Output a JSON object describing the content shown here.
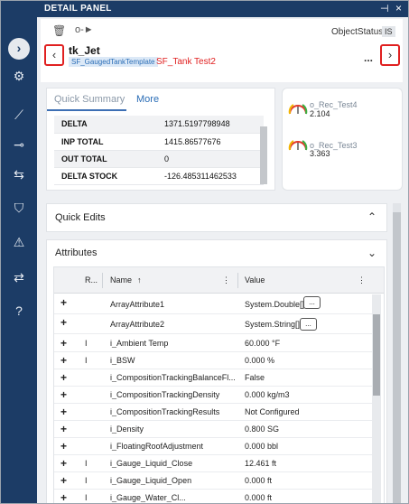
{
  "window": {
    "title": "DETAIL PANEL",
    "pin_icon": "pin-icon",
    "close_icon": "close-icon"
  },
  "rail": {
    "toggle": "›",
    "icons": [
      "chevron-right-icon",
      "dashboard-gear-icon",
      "trend-icon",
      "key-icon",
      "compare-arrows-icon",
      "shield-info-icon",
      "alert-icon",
      "swap-icon",
      "help-icon"
    ]
  },
  "header": {
    "object_status_label": "ObjectStatus",
    "object_status_value": "IS",
    "name": "tk_Jet",
    "template": "SF_GaugedTankTemplate",
    "related": "SF_Tank Test2",
    "prev": "‹",
    "next": "›",
    "more": "..."
  },
  "summary": {
    "tabs": [
      "Quick Summary",
      "More"
    ],
    "rows": [
      {
        "key": "DELTA",
        "value": "1371.5197798948"
      },
      {
        "key": "INP TOTAL",
        "value": "1415.86577676"
      },
      {
        "key": "OUT TOTAL",
        "value": "0"
      },
      {
        "key": "DELTA STOCK",
        "value": "-126.485311462533"
      }
    ]
  },
  "gauges": [
    {
      "name": "o_Rec_Test4",
      "value": "2.104"
    },
    {
      "name": "o_Rec_Test3",
      "value": "3.363"
    }
  ],
  "quick_edits": {
    "label": "Quick Edits",
    "chevron": "^"
  },
  "attributes": {
    "label": "Attributes",
    "chevron": "v",
    "columns": {
      "r": "R...",
      "name": "Name",
      "sort": "↑",
      "value": "Value",
      "menu": "⋮"
    },
    "rows": [
      {
        "r": "",
        "name": "ArrayAttribute1",
        "value": "System.Double[]",
        "more": "..."
      },
      {
        "r": "",
        "name": "ArrayAttribute2",
        "value": "System.String[]",
        "more": "..."
      },
      {
        "r": "I",
        "name": "i_Ambient Temp",
        "value": "60.000 °F"
      },
      {
        "r": "I",
        "name": "i_BSW",
        "value": "0.000 %"
      },
      {
        "r": "",
        "name": "i_CompositionTrackingBalanceFl...",
        "value": "False"
      },
      {
        "r": "",
        "name": "i_CompositionTrackingDensity",
        "value": "0.000 kg/m3"
      },
      {
        "r": "",
        "name": "i_CompositionTrackingResults",
        "value": "Not Configured"
      },
      {
        "r": "",
        "name": "i_Density",
        "value": "0.800 SG"
      },
      {
        "r": "",
        "name": "i_FloatingRoofAdjustment",
        "value": "0.000 bbl"
      },
      {
        "r": "I",
        "name": "i_Gauge_Liquid_Close",
        "value": "12.461 ft"
      },
      {
        "r": "I",
        "name": "i_Gauge_Liquid_Open",
        "value": "0.000 ft"
      },
      {
        "r": "I",
        "name": "i_Gauge_Water_Cl...",
        "value": "0.000 ft"
      }
    ]
  }
}
